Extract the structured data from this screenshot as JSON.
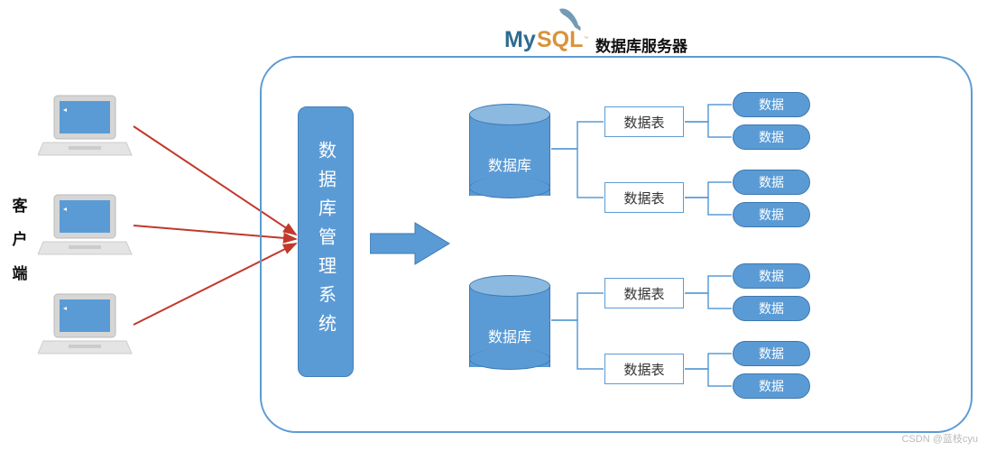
{
  "labels": {
    "client": "客户端",
    "server": "数据库服务器",
    "dbms": "数据库管理系统",
    "database": "数据库",
    "table": "数据表",
    "data": "数据"
  },
  "logo": {
    "my": "My",
    "sql": "SQL"
  },
  "watermark": "CSDN @蓝枝cyu",
  "structure": {
    "clients": 3,
    "databases": 2,
    "tables_per_db": 2,
    "data_per_table": 2
  }
}
